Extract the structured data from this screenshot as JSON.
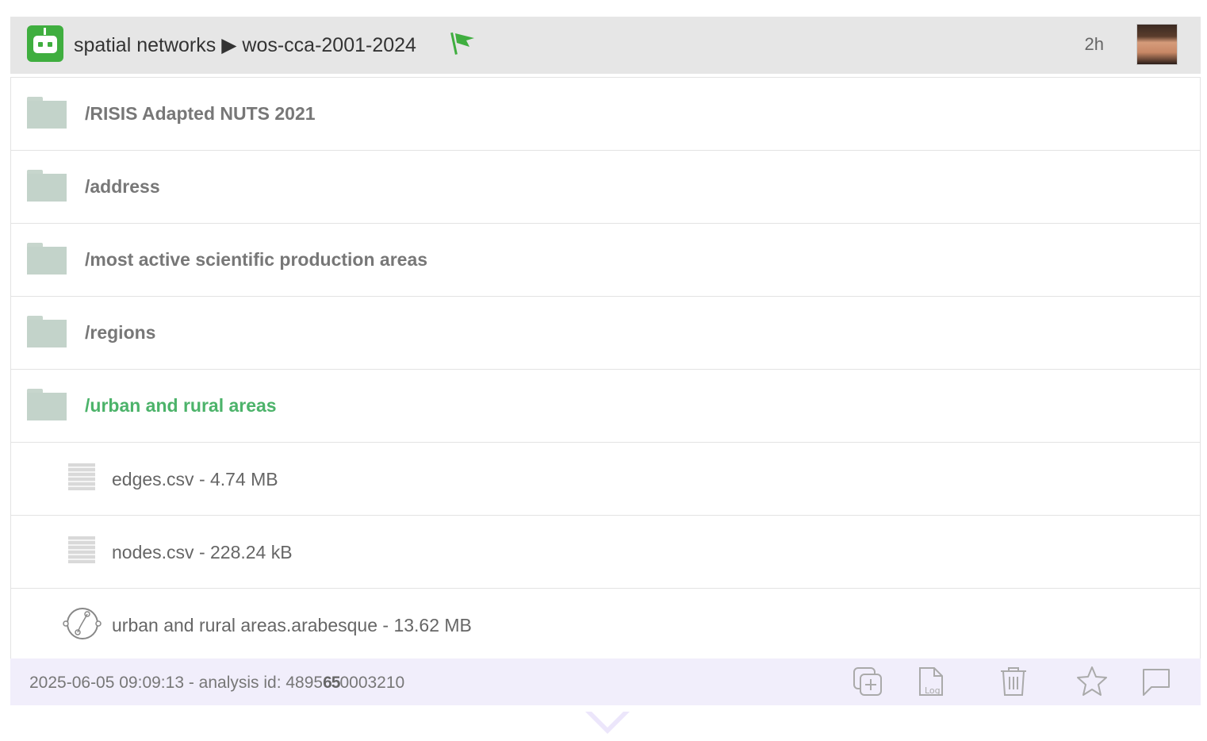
{
  "header": {
    "project": "spatial networks",
    "separator": "▶",
    "analysis": "wos-cca-2001-2024",
    "time_ago": "2h",
    "colors": {
      "bot": "#3fae3f",
      "flag": "#3fae3f"
    }
  },
  "folders": [
    {
      "label": "/RISIS Adapted NUTS 2021",
      "active": false
    },
    {
      "label": "/address",
      "active": false
    },
    {
      "label": "/most active scientific production areas",
      "active": false
    },
    {
      "label": "/regions",
      "active": false
    },
    {
      "label": "/urban and rural areas",
      "active": true
    }
  ],
  "files": [
    {
      "label": "edges.csv - 4.74 MB",
      "icon": "csv-file-icon"
    },
    {
      "label": "nodes.csv - 228.24 kB",
      "icon": "csv-file-icon"
    },
    {
      "label": "urban and rural areas.arabesque - 13.62 MB",
      "icon": "network-graph-icon"
    }
  ],
  "footer": {
    "prefix": "2025-06-05 09:09:13 - analysis id: 4895",
    "bold": "65",
    "suffix": "0003210",
    "icons": [
      "duplicate-icon",
      "log-file-icon",
      "trash-icon",
      "star-icon",
      "comment-icon"
    ]
  }
}
